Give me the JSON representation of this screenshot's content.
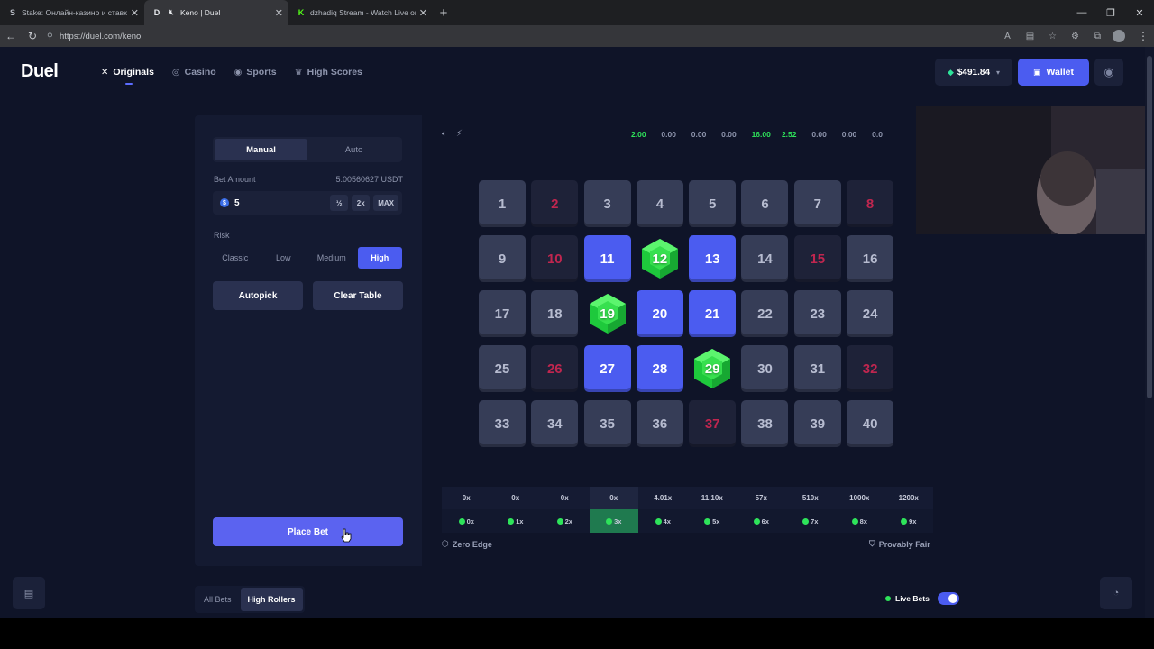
{
  "browser": {
    "tabs": [
      {
        "icon": "S",
        "title": "Stake: Онлайн-казино и ставки н",
        "active": false
      },
      {
        "icon": "D",
        "title": "Keno | Duel",
        "active": true
      },
      {
        "icon": "K",
        "title": "dzhadiq Stream - Watch Live on K",
        "active": false
      }
    ],
    "url": "https://duel.com/keno"
  },
  "header": {
    "logo": "Duel",
    "nav": [
      {
        "label": "Originals",
        "icon": "✕"
      },
      {
        "label": "Casino",
        "icon": "◎"
      },
      {
        "label": "Sports",
        "icon": "◉"
      },
      {
        "label": "High Scores",
        "icon": "♛"
      }
    ],
    "balance": "$491.84",
    "wallet_label": "Wallet"
  },
  "panel": {
    "modes": [
      "Manual",
      "Auto"
    ],
    "bet_amount_label": "Bet Amount",
    "bet_amount_usdt": "5.00560627 USDT",
    "bet_value": "5",
    "coin_symbol": "$",
    "half_label": "½",
    "double_label": "2x",
    "max_label": "MAX",
    "risk_label": "Risk",
    "risk_options": [
      "Classic",
      "Low",
      "Medium",
      "High"
    ],
    "risk_selected": "High",
    "autopick_label": "Autopick",
    "clear_label": "Clear Table",
    "place_bet_label": "Place Bet"
  },
  "game": {
    "multipliers": [
      "2.00",
      "0.00",
      "0.00",
      "0.00",
      "16.00",
      "2.52",
      "0.00",
      "0.00",
      "0.0"
    ],
    "tiles": [
      {
        "n": "1",
        "state": "normal"
      },
      {
        "n": "2",
        "state": "miss"
      },
      {
        "n": "3",
        "state": "normal"
      },
      {
        "n": "4",
        "state": "normal"
      },
      {
        "n": "5",
        "state": "normal"
      },
      {
        "n": "6",
        "state": "normal"
      },
      {
        "n": "7",
        "state": "normal"
      },
      {
        "n": "8",
        "state": "miss"
      },
      {
        "n": "9",
        "state": "normal"
      },
      {
        "n": "10",
        "state": "miss"
      },
      {
        "n": "11",
        "state": "pick"
      },
      {
        "n": "12",
        "state": "gem"
      },
      {
        "n": "13",
        "state": "pick"
      },
      {
        "n": "14",
        "state": "normal"
      },
      {
        "n": "15",
        "state": "miss"
      },
      {
        "n": "16",
        "state": "normal"
      },
      {
        "n": "17",
        "state": "normal"
      },
      {
        "n": "18",
        "state": "normal"
      },
      {
        "n": "19",
        "state": "gem"
      },
      {
        "n": "20",
        "state": "pick"
      },
      {
        "n": "21",
        "state": "pick"
      },
      {
        "n": "22",
        "state": "normal"
      },
      {
        "n": "23",
        "state": "normal"
      },
      {
        "n": "24",
        "state": "normal"
      },
      {
        "n": "25",
        "state": "normal"
      },
      {
        "n": "26",
        "state": "miss"
      },
      {
        "n": "27",
        "state": "pick"
      },
      {
        "n": "28",
        "state": "pick"
      },
      {
        "n": "29",
        "state": "gem"
      },
      {
        "n": "30",
        "state": "normal"
      },
      {
        "n": "31",
        "state": "normal"
      },
      {
        "n": "32",
        "state": "miss"
      },
      {
        "n": "33",
        "state": "normal"
      },
      {
        "n": "34",
        "state": "normal"
      },
      {
        "n": "35",
        "state": "normal"
      },
      {
        "n": "36",
        "state": "normal"
      },
      {
        "n": "37",
        "state": "miss"
      },
      {
        "n": "38",
        "state": "normal"
      },
      {
        "n": "39",
        "state": "normal"
      },
      {
        "n": "40",
        "state": "normal"
      }
    ],
    "paytable": [
      {
        "payout": "0x",
        "hits": "0x"
      },
      {
        "payout": "0x",
        "hits": "1x"
      },
      {
        "payout": "0x",
        "hits": "2x"
      },
      {
        "payout": "0x",
        "hits": "3x"
      },
      {
        "payout": "4.01x",
        "hits": "4x"
      },
      {
        "payout": "11.10x",
        "hits": "5x"
      },
      {
        "payout": "57x",
        "hits": "6x"
      },
      {
        "payout": "510x",
        "hits": "7x"
      },
      {
        "payout": "1000x",
        "hits": "8x"
      },
      {
        "payout": "1200x",
        "hits": "9x"
      }
    ],
    "paytable_highlight_index": 3,
    "zero_edge_label": "Zero Edge",
    "provably_fair_label": "Provably Fair"
  },
  "bets": {
    "tabs": [
      "All Bets",
      "High Rollers"
    ],
    "active_tab": "High Rollers",
    "live_bets_label": "Live Bets",
    "live_bets_on": true
  },
  "colors": {
    "accent": "#4b5cf0",
    "gem": "#2ee35a",
    "miss": "#c0264f",
    "background": "#0f1428"
  }
}
